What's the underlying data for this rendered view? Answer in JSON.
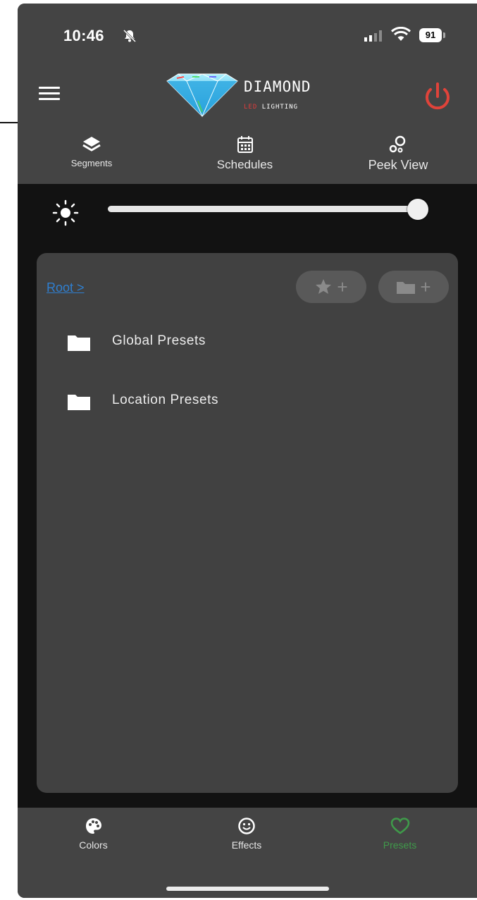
{
  "status_bar": {
    "time": "10:46",
    "battery": "91"
  },
  "header": {
    "brand_title": "DIAMOND",
    "brand_sub_prefix": "LED",
    "brand_sub": "LIGHTING"
  },
  "toolbar": [
    {
      "label": "Segments",
      "icon": "layers-icon"
    },
    {
      "label": "Schedules",
      "icon": "calendar-icon"
    },
    {
      "label": "Peek View",
      "icon": "bubbles-icon"
    }
  ],
  "brightness": {
    "level_percent": 100,
    "icon": "sun-icon"
  },
  "presets": {
    "breadcrumb": "Root >",
    "actions": [
      {
        "icon": "star-icon",
        "suffix": "+"
      },
      {
        "icon": "folder-icon",
        "suffix": "+"
      }
    ],
    "folders": [
      {
        "label": "Global Presets"
      },
      {
        "label": "Location Presets"
      }
    ]
  },
  "bottom_nav": [
    {
      "label": "Colors",
      "icon": "palette-icon"
    },
    {
      "label": "Effects",
      "icon": "smiley-icon"
    },
    {
      "label": "Presets",
      "icon": "heart-icon",
      "active": true
    }
  ],
  "colors": {
    "active_tab": "#3f9a4a",
    "power": "#e0433a",
    "link": "#2f7fd0"
  }
}
